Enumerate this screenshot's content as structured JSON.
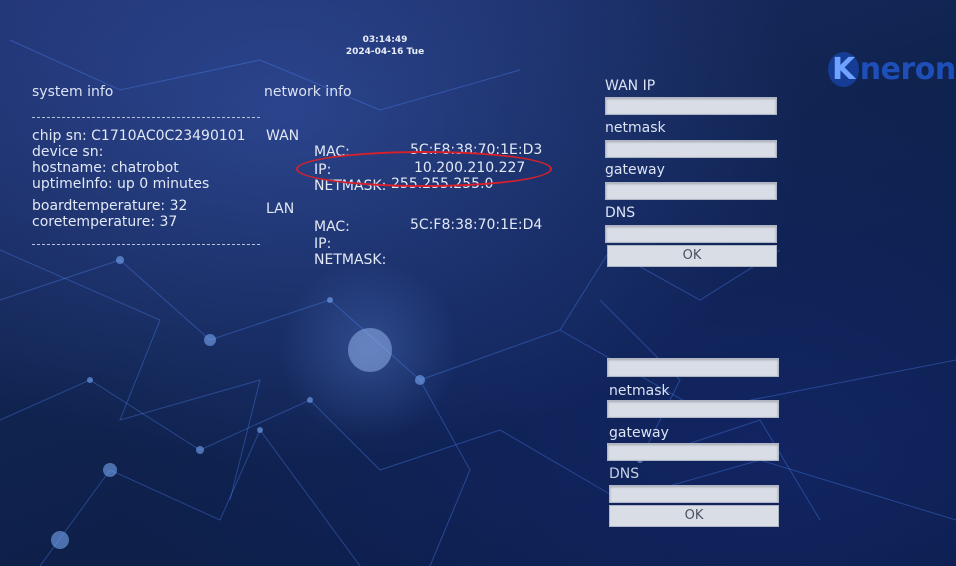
{
  "clock": {
    "time": "03:14:49",
    "date": "2024-04-16 Tue"
  },
  "brand": {
    "logo_initial": "K",
    "logo_rest": "neron"
  },
  "system_info": {
    "heading": "system info",
    "lines": [
      "chip sn: C1710AC0C23490101",
      "device sn:",
      "hostname: chatrobot",
      "uptimeInfo: up 0 minutes",
      "boardtemperature: 32",
      "coretemperature: 37"
    ]
  },
  "network_info": {
    "heading": "network info",
    "wan": {
      "label": "WAN",
      "mac_label": "MAC:",
      "mac": "5C:F8:38:70:1E:D3",
      "ip_label": "IP:",
      "ip": "10.200.210.227",
      "netmask_label": "NETMASK:",
      "netmask": "255.255.255.0"
    },
    "lan": {
      "label": "LAN",
      "mac_label": "MAC:",
      "mac": "5C:F8:38:70:1E:D4",
      "ip_label": "IP:",
      "netmask_label": "NETMASK:"
    }
  },
  "wan_form": {
    "ip_label": "WAN IP",
    "netmask_label": "netmask",
    "gateway_label": "gateway",
    "dns_label": "DNS",
    "ok_label": "OK"
  },
  "lan_form": {
    "netmask_label": "netmask",
    "gateway_label": "gateway",
    "dns_label": "DNS",
    "ok_label": "OK"
  },
  "colors": {
    "highlight_ellipse": "#d8202a",
    "field_bg": "#d9dde6"
  }
}
